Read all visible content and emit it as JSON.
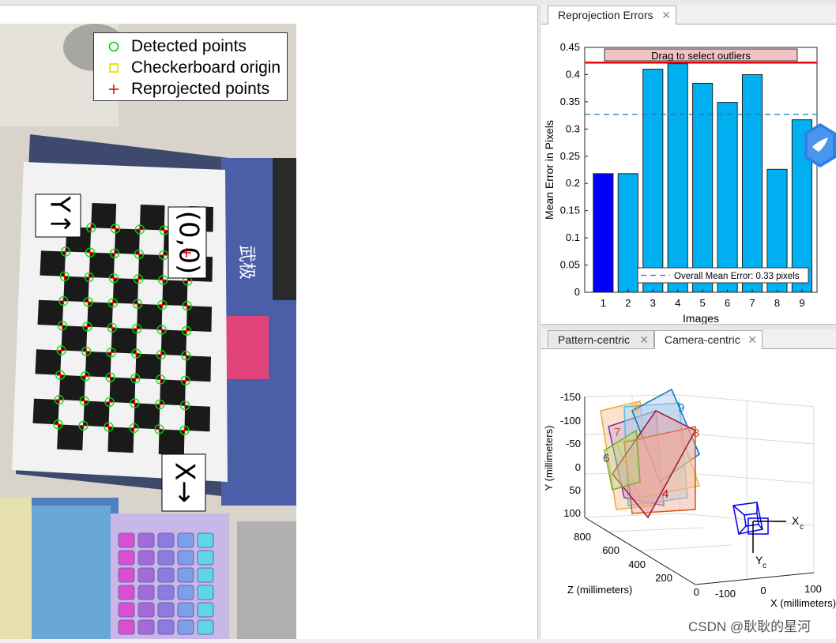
{
  "legend": {
    "detected": "Detected points",
    "origin": "Checkerboard origin",
    "reprojected": "Reprojected points"
  },
  "image_labels": {
    "y_axis": "Y↑",
    "origin": "(0,0)",
    "x_axis": "X→"
  },
  "top_tabs": [
    {
      "label": "Reprojection Errors",
      "active": true
    }
  ],
  "bottom_tabs": [
    {
      "label": "Pattern-centric",
      "active": false
    },
    {
      "label": "Camera-centric",
      "active": true
    }
  ],
  "colors": {
    "bar": "#00b0f0",
    "bar_selected": "#0000ff",
    "threshold": "#e8000b",
    "mean_line": "#1f77b4"
  },
  "chart_data": {
    "type": "bar",
    "categories": [
      "1",
      "2",
      "3",
      "4",
      "5",
      "6",
      "7",
      "8",
      "9"
    ],
    "values": [
      0.218,
      0.218,
      0.41,
      0.42,
      0.384,
      0.349,
      0.4,
      0.226,
      0.317
    ],
    "selected_index": 0,
    "xlabel": "Images",
    "ylabel": "Mean Error in Pixels",
    "ylim": [
      0,
      0.45
    ],
    "yticks": [
      "0",
      "0.05",
      "0.1",
      "0.15",
      "0.2",
      "0.25",
      "0.3",
      "0.35",
      "0.4",
      "0.45"
    ],
    "overall_mean": 0.327,
    "threshold": 0.422,
    "drag_label": "Drag to select outliers",
    "legend_entry": "Overall Mean Error: 0.33 pixels"
  },
  "plot3d": {
    "y_label": "Y (millimeters)",
    "z_label": "Z (millimeters)",
    "x_label": "X (millimeters)",
    "y_ticks": [
      "-150",
      "-100",
      "-50",
      "0",
      "50",
      "100"
    ],
    "z_ticks": [
      "800",
      "600",
      "400",
      "200",
      "0"
    ],
    "x_ticks": [
      "-100",
      "0",
      "100"
    ],
    "cam_x": "X",
    "cam_y": "Y",
    "sub": "c",
    "board_numbers": [
      "8",
      "9",
      "7",
      "3",
      "6",
      "4"
    ]
  },
  "watermark": "CSDN @耿耿的星河"
}
